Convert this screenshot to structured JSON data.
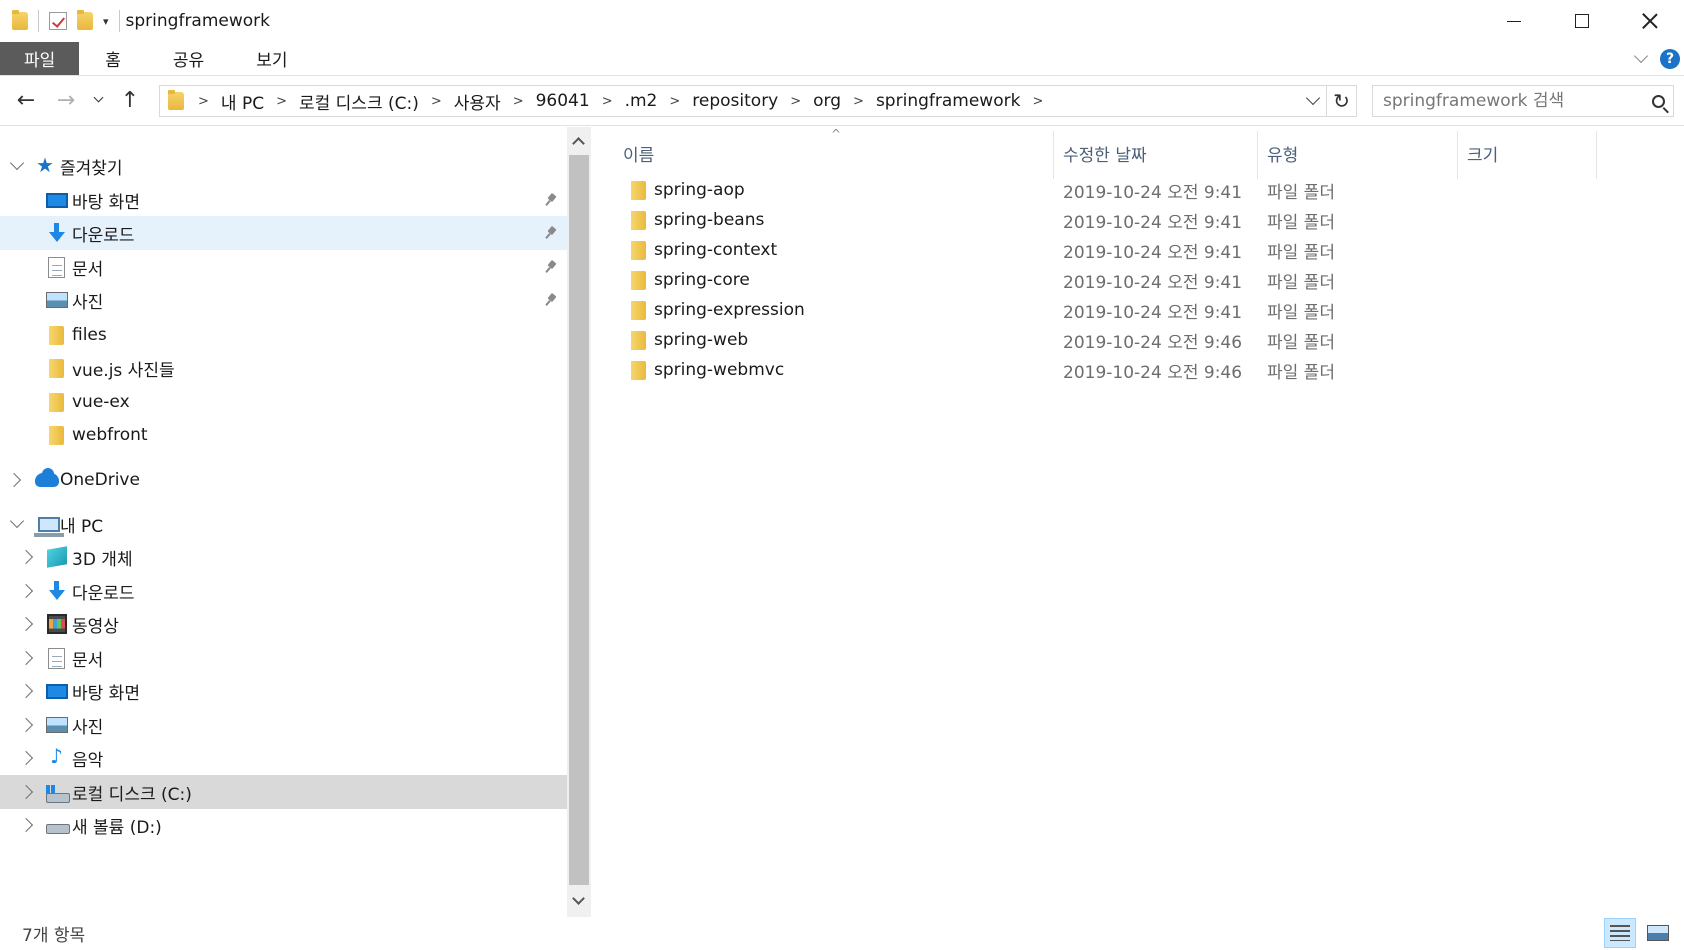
{
  "window": {
    "title": "springframework"
  },
  "ribbon": {
    "tabs": [
      "파일",
      "홈",
      "공유",
      "보기"
    ],
    "help": "?"
  },
  "address": {
    "crumbs": [
      "내 PC",
      "로컬 디스크 (C:)",
      "사용자",
      "96041",
      ".m2",
      "repository",
      "org",
      "springframework"
    ]
  },
  "search": {
    "placeholder": "springframework 검색"
  },
  "sidebar": {
    "quick_access": {
      "label": "즐겨찾기",
      "items": [
        {
          "label": "바탕 화면",
          "icon": "desktop-icon",
          "pinned": true
        },
        {
          "label": "다운로드",
          "icon": "download-icon",
          "pinned": true,
          "selected": true
        },
        {
          "label": "문서",
          "icon": "document-icon",
          "pinned": true
        },
        {
          "label": "사진",
          "icon": "pictures-icon",
          "pinned": true
        },
        {
          "label": "files",
          "icon": "folder-icon"
        },
        {
          "label": "vue.js 사진들",
          "icon": "folder-icon"
        },
        {
          "label": "vue-ex",
          "icon": "folder-icon"
        },
        {
          "label": "webfront",
          "icon": "folder-icon"
        }
      ]
    },
    "onedrive": {
      "label": "OneDrive"
    },
    "this_pc": {
      "label": "내 PC",
      "items": [
        {
          "label": "3D 개체",
          "icon": "3d-objects-icon"
        },
        {
          "label": "다운로드",
          "icon": "download-icon"
        },
        {
          "label": "동영상",
          "icon": "video-icon"
        },
        {
          "label": "문서",
          "icon": "document-icon"
        },
        {
          "label": "바탕 화면",
          "icon": "desktop-icon"
        },
        {
          "label": "사진",
          "icon": "pictures-icon"
        },
        {
          "label": "음악",
          "icon": "music-icon"
        },
        {
          "label": "로컬 디스크 (C:)",
          "icon": "drive-icon",
          "selected": true
        },
        {
          "label": "새 볼륨 (D:)",
          "icon": "drive-icon"
        }
      ]
    }
  },
  "columns": {
    "name": "이름",
    "date": "수정한 날짜",
    "type": "유형",
    "size": "크기"
  },
  "files": [
    {
      "name": "spring-aop",
      "date": "2019-10-24 오전 9:41",
      "type": "파일 폴더"
    },
    {
      "name": "spring-beans",
      "date": "2019-10-24 오전 9:41",
      "type": "파일 폴더"
    },
    {
      "name": "spring-context",
      "date": "2019-10-24 오전 9:41",
      "type": "파일 폴더"
    },
    {
      "name": "spring-core",
      "date": "2019-10-24 오전 9:41",
      "type": "파일 폴더"
    },
    {
      "name": "spring-expression",
      "date": "2019-10-24 오전 9:41",
      "type": "파일 폴더"
    },
    {
      "name": "spring-web",
      "date": "2019-10-24 오전 9:46",
      "type": "파일 폴더"
    },
    {
      "name": "spring-webmvc",
      "date": "2019-10-24 오전 9:46",
      "type": "파일 폴더"
    }
  ],
  "status": {
    "item_count": "7개 항목"
  },
  "colors": {
    "accent": "#1a73c9",
    "selected_bg": "#e5f1fb",
    "file_tab_bg": "#5b5b5b",
    "header_text": "#4c607a"
  }
}
